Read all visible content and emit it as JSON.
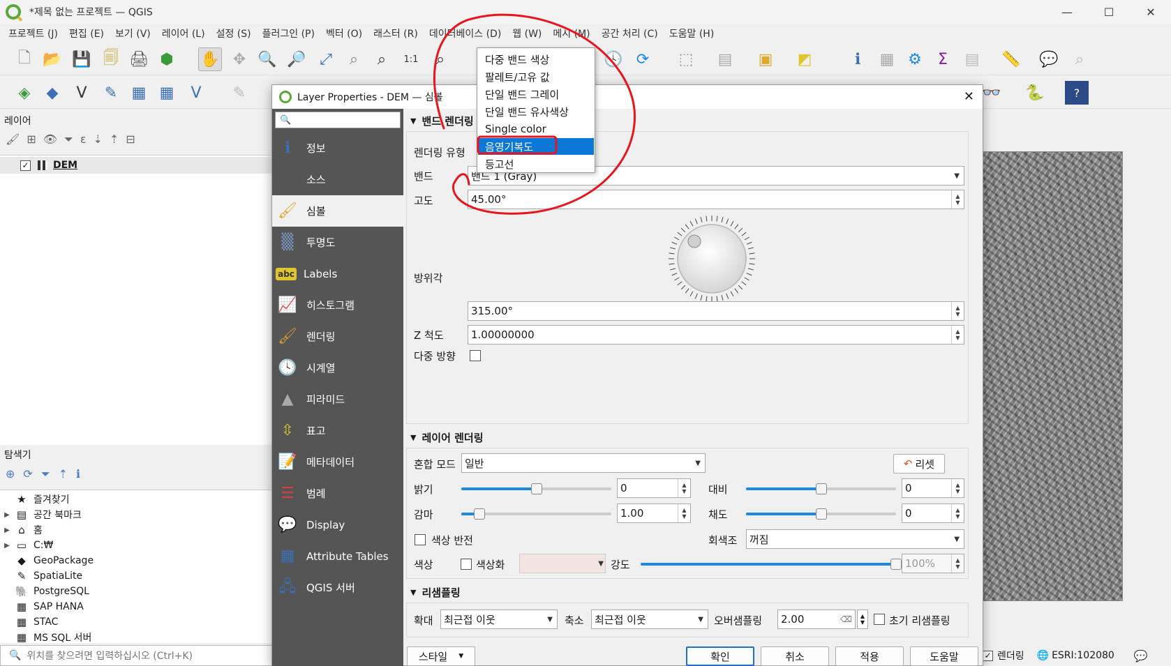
{
  "window": {
    "title": "*제목 없는 프로젝트 — QGIS",
    "minimize": "—",
    "maximize": "☐",
    "close": "✕"
  },
  "menubar": [
    "프로젝트 (J)",
    "편집 (E)",
    "보기 (V)",
    "레이어 (L)",
    "설정 (S)",
    "플러그인 (P)",
    "벡터 (O)",
    "래스터 (R)",
    "데이터베이스 (D)",
    "웹 (W)",
    "메시 (M)",
    "공간 처리 (C)",
    "도움말 (H)"
  ],
  "layers_panel": {
    "title": "레이어",
    "layer": {
      "name": "DEM",
      "checked": "✓"
    }
  },
  "browser_panel": {
    "title": "탐색기",
    "items": [
      {
        "label": "즐겨찾기",
        "icon": "★",
        "exp": ""
      },
      {
        "label": "공간 북마크",
        "icon": "▤",
        "exp": "▶"
      },
      {
        "label": "홈",
        "icon": "⌂",
        "exp": "▶"
      },
      {
        "label": "C:₩",
        "icon": "▭",
        "exp": "▶"
      },
      {
        "label": "GeoPackage",
        "icon": "◆",
        "exp": ""
      },
      {
        "label": "SpatiaLite",
        "icon": "✎",
        "exp": ""
      },
      {
        "label": "PostgreSQL",
        "icon": "🐘",
        "exp": ""
      },
      {
        "label": "SAP HANA",
        "icon": "▦",
        "exp": ""
      },
      {
        "label": "STAC",
        "icon": "▦",
        "exp": ""
      },
      {
        "label": "MS SQL 서버",
        "icon": "▦",
        "exp": ""
      }
    ]
  },
  "locator": {
    "placeholder": "위치를 찾으려면 입력하십시오 (Ctrl+K)"
  },
  "statusbar": {
    "render": "렌더링",
    "crs": "ESRI:102080",
    "render_checked": "✓"
  },
  "dialog": {
    "title": "Layer Properties - DEM — 심볼",
    "close": "✕",
    "nav": [
      {
        "label": "정보",
        "icon": "ℹ"
      },
      {
        "label": "소스",
        "icon": "⚙"
      },
      {
        "label": "심볼",
        "icon": "🖌"
      },
      {
        "label": "투명도",
        "icon": "▒"
      },
      {
        "label": "Labels",
        "icon": "abc"
      },
      {
        "label": "히스토그램",
        "icon": "📈"
      },
      {
        "label": "렌더링",
        "icon": "🖌"
      },
      {
        "label": "시계열",
        "icon": "🕓"
      },
      {
        "label": "피라미드",
        "icon": "▲"
      },
      {
        "label": "표고",
        "icon": "⇳"
      },
      {
        "label": "메타데이터",
        "icon": "📝"
      },
      {
        "label": "범례",
        "icon": "☰"
      },
      {
        "label": "Display",
        "icon": "💬"
      },
      {
        "label": "Attribute Tables",
        "icon": "▦"
      },
      {
        "label": "QGIS 서버",
        "icon": "🖧"
      }
    ],
    "band_rendering": {
      "header": "밴드 렌더링",
      "render_type_label": "렌더링 유형",
      "band_label": "밴드",
      "band_value": "밴드 1 (Gray)",
      "altitude_label": "고도",
      "altitude_value": "45.00°",
      "azimuth_label": "방위각",
      "azimuth_value": "315.00°",
      "z_label": "Z 척도",
      "z_value": "1.00000000",
      "multi_label": "다중 방향"
    },
    "render_type_options": [
      "다중 밴드 색상",
      "팔레트/고유 값",
      "단일 밴드 그레이",
      "단일 밴드 유사색상",
      "Single color",
      "음영기복도",
      "등고선"
    ],
    "render_type_selected_index": 5,
    "layer_rendering": {
      "header": "레이어 렌더링",
      "blend_label": "혼합 모드",
      "blend_value": "일반",
      "reset": "리셋",
      "brightness_label": "밝기",
      "brightness_value": "0",
      "brightness_level": 0.5,
      "contrast_label": "대비",
      "contrast_value": "0",
      "contrast_level": 0.5,
      "gamma_label": "감마",
      "gamma_value": "1.00",
      "gamma_level": 0.12,
      "saturation_label": "채도",
      "saturation_value": "0",
      "saturation_level": 0.5,
      "invert_label": "색상 반전",
      "grayscale_label": "회색조",
      "grayscale_value": "꺼짐",
      "hue_label": "색상",
      "colorize_label": "색상화",
      "strength_label": "강도",
      "strength_value": "100%",
      "strength_level": 1.0
    },
    "resampling": {
      "header": "리샘플링",
      "zoomin_label": "확대",
      "zoomin_value": "최근접 이웃",
      "zoomout_label": "축소",
      "zoomout_value": "최근접 이웃",
      "oversample_label": "오버샘플링",
      "oversample_value": "2.00",
      "early_label": "초기 리샘플링"
    },
    "footer": {
      "style": "스타일",
      "ok": "확인",
      "cancel": "취소",
      "apply": "적용",
      "help": "도움말"
    }
  },
  "colors": {
    "accent": "#1e88e5",
    "selection": "#0b78d7",
    "sidebar": "#555555",
    "annotation": "#e8141e"
  }
}
